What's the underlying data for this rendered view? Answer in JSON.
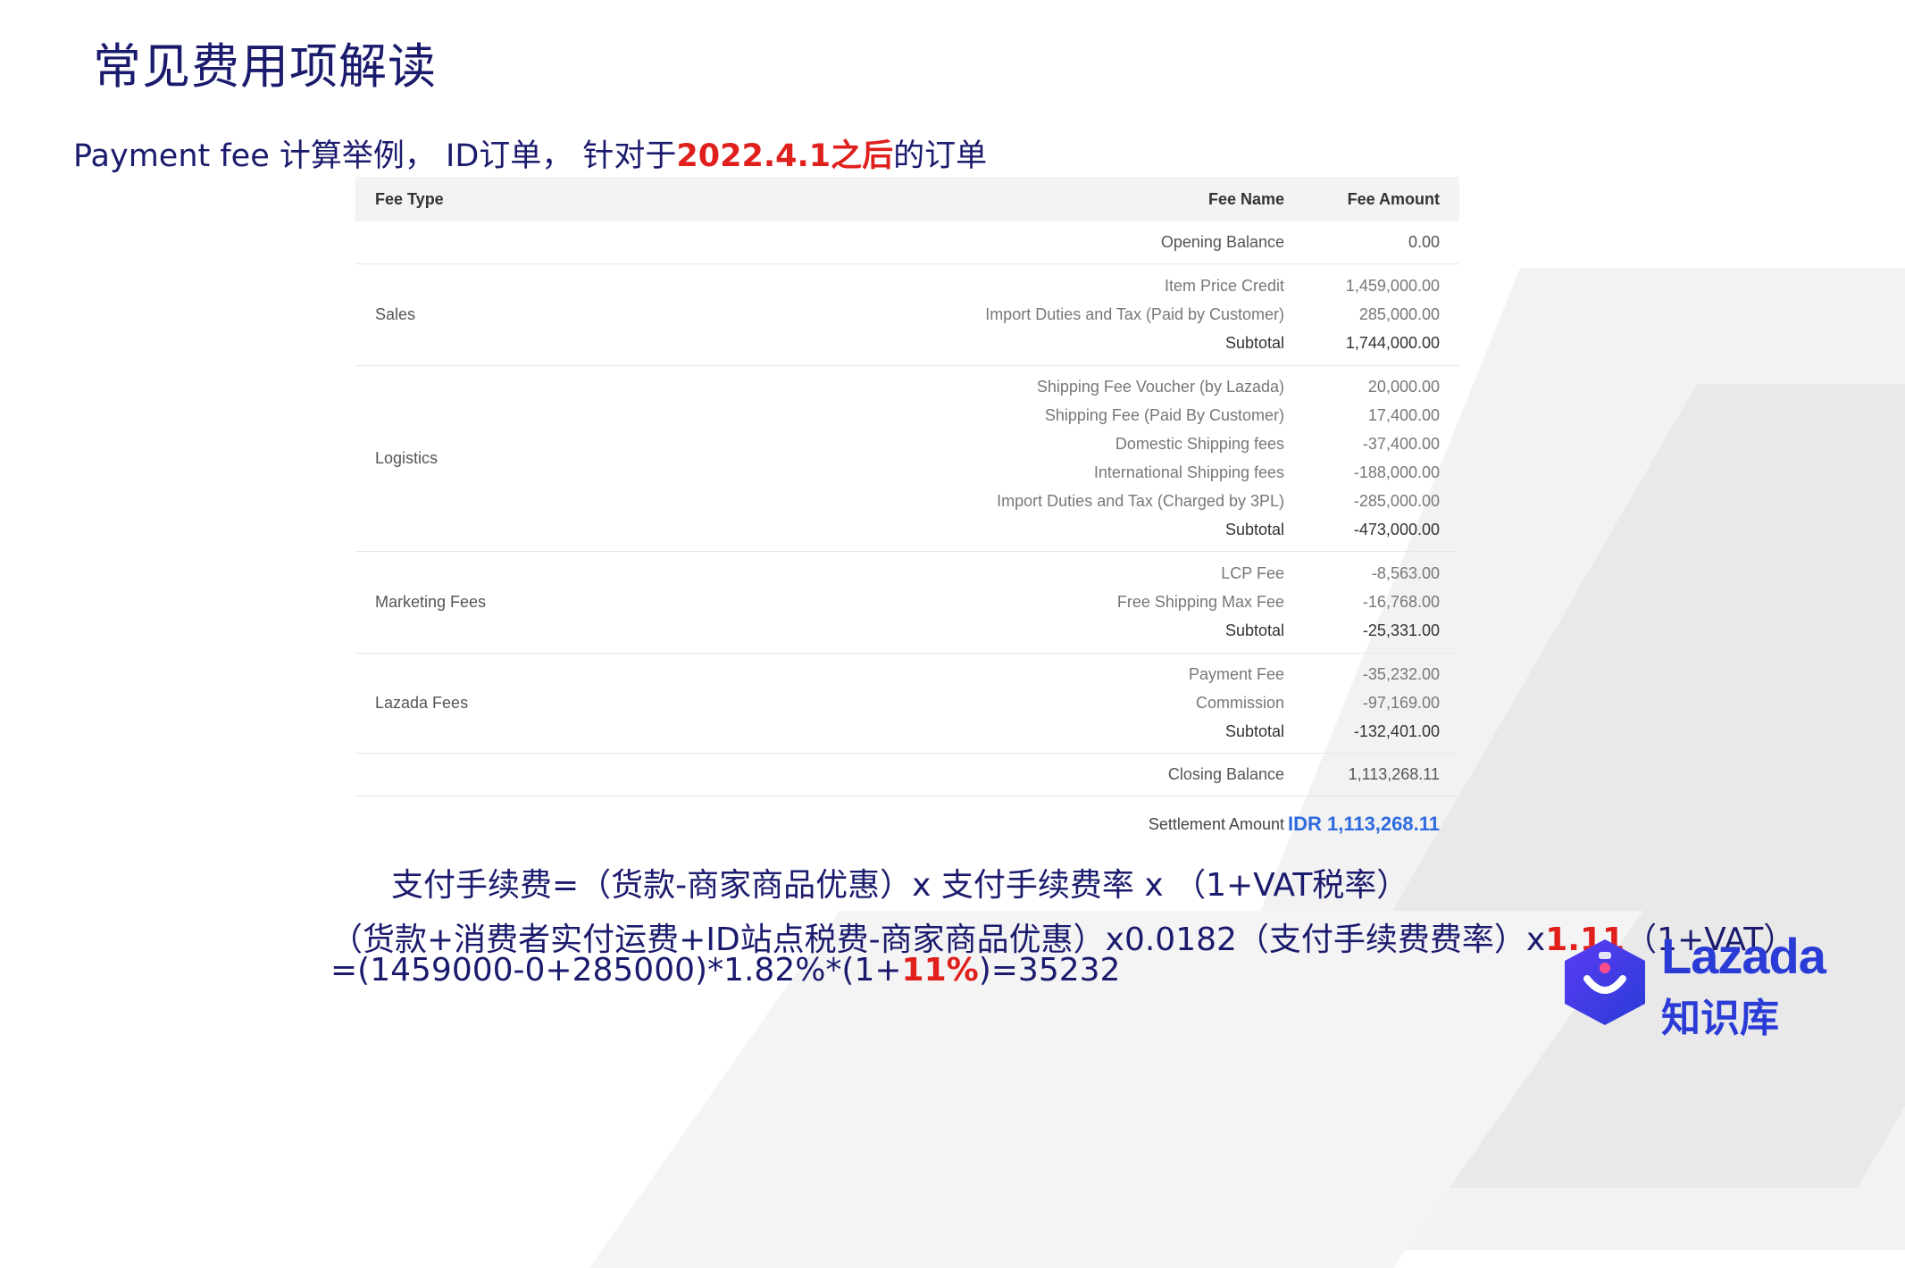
{
  "title": "常见费用项解读",
  "subtitle": {
    "prefix": "Payment fee 计算举例， ID订单， 针对于",
    "highlight": "2022.4.1之后",
    "suffix": "的订单"
  },
  "table": {
    "headers": {
      "type": "Fee Type",
      "name": "Fee Name",
      "amount": "Fee Amount"
    },
    "opening": {
      "name": "Opening Balance",
      "amount": "0.00"
    },
    "groups": [
      {
        "type": "Sales",
        "rows": [
          {
            "name": "Item Price Credit",
            "amount": "1,459,000.00"
          },
          {
            "name": "Import Duties and Tax (Paid by Customer)",
            "amount": "285,000.00"
          },
          {
            "name": "Subtotal",
            "amount": "1,744,000.00"
          }
        ]
      },
      {
        "type": "Logistics",
        "rows": [
          {
            "name": "Shipping Fee Voucher (by Lazada)",
            "amount": "20,000.00"
          },
          {
            "name": "Shipping Fee (Paid By Customer)",
            "amount": "17,400.00"
          },
          {
            "name": "Domestic Shipping fees",
            "amount": "-37,400.00"
          },
          {
            "name": "International Shipping fees",
            "amount": "-188,000.00"
          },
          {
            "name": "Import Duties and Tax (Charged by 3PL)",
            "amount": "-285,000.00"
          },
          {
            "name": "Subtotal",
            "amount": "-473,000.00"
          }
        ]
      },
      {
        "type": "Marketing Fees",
        "rows": [
          {
            "name": "LCP Fee",
            "amount": "-8,563.00"
          },
          {
            "name": "Free Shipping Max Fee",
            "amount": "-16,768.00"
          },
          {
            "name": "Subtotal",
            "amount": "-25,331.00"
          }
        ]
      },
      {
        "type": "Lazada Fees",
        "rows": [
          {
            "name": "Payment Fee",
            "amount": "-35,232.00"
          },
          {
            "name": "Commission",
            "amount": "-97,169.00"
          },
          {
            "name": "Subtotal",
            "amount": "-132,401.00"
          }
        ]
      }
    ],
    "closing": {
      "name": "Closing Balance",
      "amount": "1,113,268.11"
    },
    "settlement": {
      "name": "Settlement Amount",
      "amount": "IDR 1,113,268.11"
    }
  },
  "formula": {
    "line1": "支付手续费=（货款-商家商品优惠）x 支付手续费率 x （1+VAT税率）",
    "line2_prefix": "（货款+消费者实付运费+ID站点税费-商家商品优惠）x0.0182（支付手续费费率）x",
    "line2_highlight": "1.11",
    "line2_suffix": "（1+VAT）",
    "line3_prefix": "=(1459000-0+285000)*1.82%*(1+",
    "line3_highlight": "11%",
    "line3_suffix": ")=35232"
  },
  "logo": {
    "word": "Lazada",
    "sub": "知识库"
  },
  "colors": {
    "navy": "#1b1b6e",
    "red": "#e0201c",
    "link_blue": "#2f6bde",
    "logo_blue": "#2a3bd6"
  }
}
